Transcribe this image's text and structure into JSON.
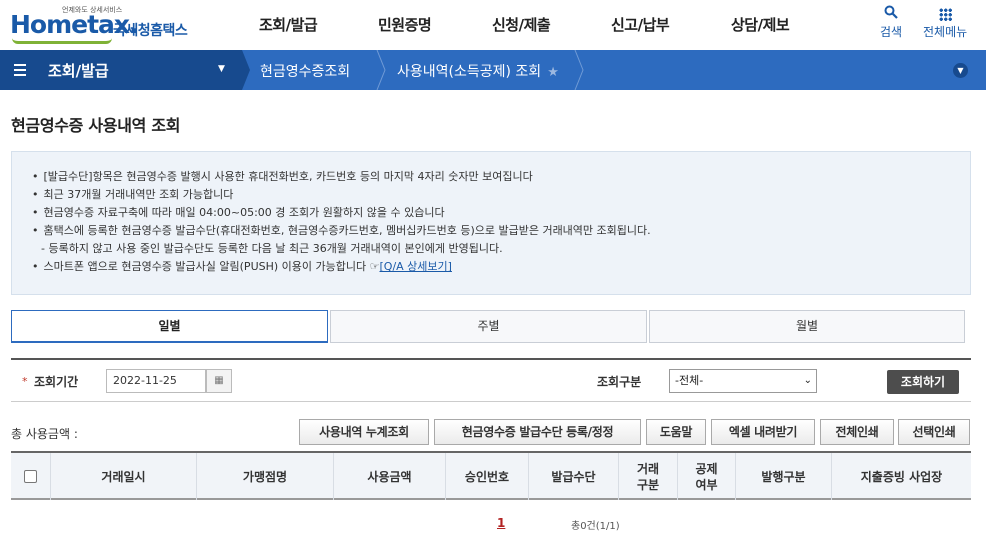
{
  "header": {
    "logo_tagline": "언제와도 상세서비스",
    "logo_brand": "Hometax.",
    "logo_brand_ko": "국세청홈택스",
    "menu": [
      "조회/발급",
      "민원증명",
      "신청/제출",
      "신고/납부",
      "상담/제보"
    ],
    "search_label": "검색",
    "all_menu_label": "전체메뉴"
  },
  "nav": {
    "section": "조회/발급",
    "crumbs": [
      "현금영수증조회",
      "사용내역(소득공제) 조회"
    ]
  },
  "page_title": "현금영수증 사용내역 조회",
  "info": {
    "items": [
      "[발급수단]항목은 현금영수증 발행시 사용한 휴대전화번호, 카드번호 등의 마지막 4자리 숫자만 보여집니다",
      "최근 37개월 거래내역만 조회 가능합니다",
      "현금영수증 자료구축에 따라 매일 04:00~05:00 경 조회가 원활하지 않을 수 있습니다",
      "홈택스에 등록한 현금영수증 발급수단(휴대전화번호, 현금영수증카드번호, 멤버십카드번호 등)으로 발급받은 거래내역만 조회됩니다.",
      "- 등록하지 않고 사용 중인 발급수단도 등록한 다음 날 최근 36개월 거래내역이 본인에게 반영됩니다.",
      "스마트폰 앱으로 현금영수증 발급사실 알림(PUSH) 이용이 가능합니다"
    ],
    "link_text": "[Q/A 상세보기]"
  },
  "tabs": [
    "일별",
    "주별",
    "월별"
  ],
  "search": {
    "period_label": "조회기간",
    "date_value": "2022-11-25",
    "type_label": "조회구분",
    "type_value": "-전체-",
    "query_button": "조회하기"
  },
  "actions": {
    "total_label": "총 사용금액 :",
    "buttons": [
      "사용내역 누계조회",
      "현금영수증 발급수단 등록/정정",
      "도움말",
      "엑셀 내려받기",
      "전체인쇄",
      "선택인쇄"
    ]
  },
  "table": {
    "columns": [
      "거래일시",
      "가맹점명",
      "사용금액",
      "승인번호",
      "발급수단",
      "거래\n구분",
      "공제\n여부",
      "발행구분",
      "지출증빙 사업장"
    ]
  },
  "pagination": {
    "current": "1",
    "total": "총0건(1/1)"
  }
}
